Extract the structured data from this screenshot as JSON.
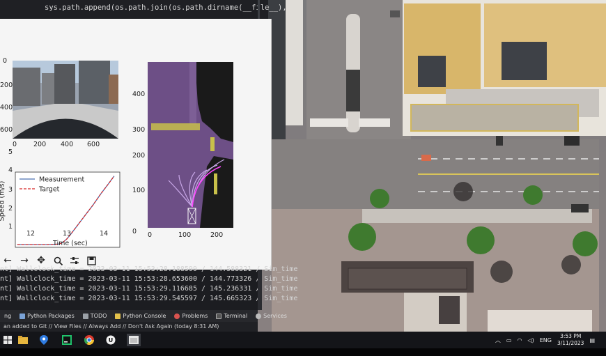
{
  "editor": {
    "code_line": "sys.path.append(os.path.join(os.path.dirname(__file__),"
  },
  "plots": {
    "camera": {
      "y_ticks": [
        "0",
        "200",
        "400",
        "600"
      ],
      "x_ticks": [
        "0",
        "200",
        "400",
        "600"
      ]
    },
    "bev": {
      "y_ticks": [
        "0",
        "100",
        "200",
        "300",
        "400"
      ],
      "x_ticks": [
        "0",
        "100",
        "200"
      ]
    },
    "speed_labels": {
      "ylabel": "Speed (m/s)",
      "xlabel": "Time (sec)",
      "y_ticks": [
        "1",
        "2",
        "3",
        "4",
        "5"
      ],
      "x_ticks": [
        "12",
        "13",
        "14"
      ]
    }
  },
  "chart_data": {
    "type": "line",
    "xlabel": "Time (sec)",
    "ylabel": "Speed (m/s)",
    "xlim": [
      11.55,
      14.3
    ],
    "ylim": [
      0.85,
      5.0
    ],
    "legend_position": "top-left",
    "series": [
      {
        "name": "Measurement",
        "color": "#4c72b0",
        "style": "solid",
        "x": [
          11.6,
          12.0,
          12.4,
          12.7,
          12.8,
          12.9,
          13.0,
          13.2,
          13.4,
          13.6,
          13.8,
          14.0,
          14.15
        ],
        "y": [
          1.0,
          1.0,
          1.0,
          1.03,
          1.12,
          1.3,
          1.55,
          2.1,
          2.65,
          3.2,
          3.8,
          4.35,
          4.78
        ]
      },
      {
        "name": "Target",
        "color": "#d62728",
        "style": "dashed",
        "x": [
          11.6,
          12.0,
          12.4,
          12.7,
          12.8,
          12.9,
          13.0,
          13.2,
          13.4,
          13.6,
          13.8,
          14.0,
          14.15
        ],
        "y": [
          1.0,
          1.0,
          1.0,
          1.03,
          1.12,
          1.3,
          1.55,
          2.1,
          2.65,
          3.2,
          3.8,
          4.35,
          4.78
        ]
      }
    ]
  },
  "terminal": {
    "lines": [
      "nt] Wallclock_time = 2023-03-11 15:53:28.188599 / 144.588321 / Sim_time",
      "nt] Wallclock_time = 2023-03-11 15:53:28.653600 / 144.773326 / Sim_time",
      "nt] Wallclock_time = 2023-03-11 15:53:29.116685 / 145.236331 / Sim_time",
      "nt] Wallclock_time = 2023-03-11 15:53:29.545597 / 145.665323 / Sim_time"
    ]
  },
  "ide_tabs": [
    "ng",
    "Python Packages",
    "TODO",
    "Python Console",
    "Problems",
    "Terminal",
    "Services"
  ],
  "statusbar": "an added to Git // View Files // Always Add // Don't Ask Again (today 8:31 AM)",
  "tray": {
    "lang": "ENG",
    "time": "3:53 PM",
    "date": "3/11/2023"
  },
  "colors": {
    "bev_purple": "#6d4f86",
    "bev_yellow": "#c8c04a",
    "ide_dark": "#1f2024"
  },
  "icons": {
    "taskbar": [
      "windows-icon",
      "file-explorer-icon",
      "maps-icon",
      "pycharm-icon",
      "chrome-icon",
      "unreal-engine-icon",
      "python-window-icon"
    ],
    "toolbar": [
      "back-icon",
      "forward-icon",
      "pan-icon",
      "zoom-icon",
      "configure-icon",
      "save-icon"
    ]
  }
}
